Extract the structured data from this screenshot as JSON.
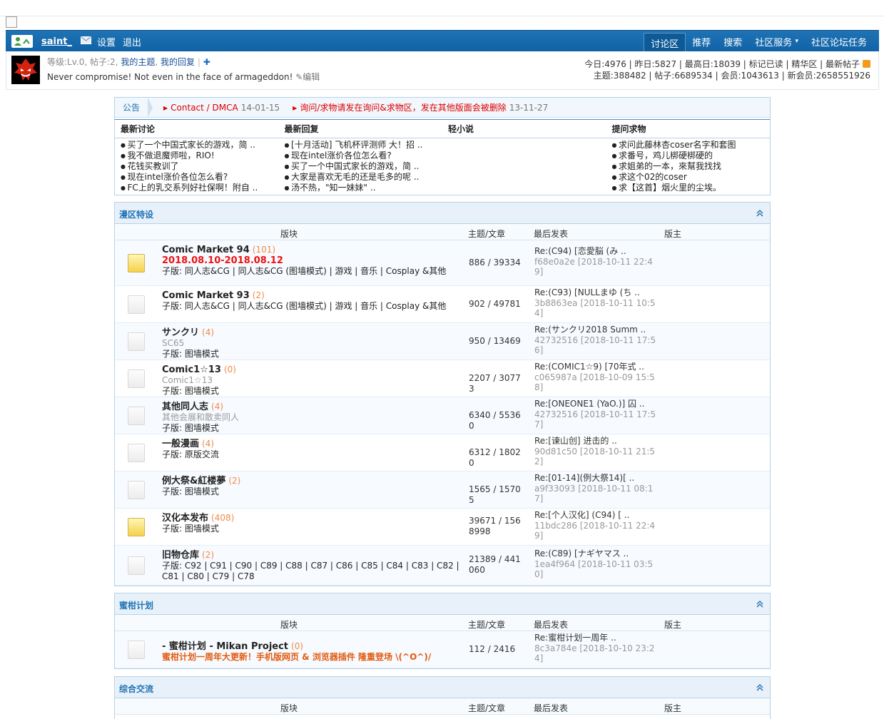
{
  "nav": {
    "username": "saint_",
    "settings": "设置",
    "logout": "退出",
    "items": [
      "讨论区",
      "推荐",
      "搜索",
      "社区服务",
      "社区论坛任务"
    ],
    "dropdown_suffix": "▾"
  },
  "userinfo": {
    "level_text": "等级:Lv.0, 帖子:2,",
    "my_topics": "我的主题",
    "sep": ",",
    "my_replies": "我的回复",
    "plus": "✚",
    "signature": "Never compromise! Not even in the face of armageddon!",
    "edit": "编辑",
    "stats_line1": "今日:4976 | 昨日:5827 | 最高日:18039 | 标记已读 | 精华区 | 最新帖子",
    "stats_line2": "主题:388482 | 帖子:6689534 | 会员:1043613 | 新会员:2658551926"
  },
  "notice": {
    "label": "公告",
    "items": [
      {
        "text": "Contact / DMCA",
        "date": "14-01-15"
      },
      {
        "text": "询问/求物请发在询问&求物区，发在其他版面会被删除",
        "date": "13-11-27"
      }
    ]
  },
  "latest": {
    "columns": [
      {
        "title": "最新讨论",
        "items": [
          "买了一个中国式家长的游戏，简 ..",
          "我不做退魔师啦，RIO!",
          "花钱买教训了",
          "现在intel涨价各位怎么看?",
          "FC上的乳交系列好社保啊！附自 .."
        ]
      },
      {
        "title": "最新回复",
        "items": [
          "[十月活动] 飞机杯评测师 大！招 ..",
          "现在intel涨价各位怎么看?",
          "买了一个中国式家长的游戏，简 ..",
          "大家是喜欢无毛的还是毛多的呢 ..",
          "汤不热，\"知一妹妹\" .."
        ]
      },
      {
        "title": "轻小说",
        "items": []
      },
      {
        "title": "提问求物",
        "items": [
          "求问此藤林杏coser名字和套图",
          "求番号，鸡儿梆硬梆硬的",
          "求姐弟的一本，來幫我找找",
          "求这个02的coser",
          "求【这首】烟火里的尘埃。"
        ]
      }
    ]
  },
  "colheads": {
    "forum": "版块",
    "topics": "主题/文章",
    "last": "最后发表",
    "mod": "版主"
  },
  "sections": [
    {
      "title": "漫区特设",
      "forums": [
        {
          "name": "Comic Market 94",
          "count": "(101)",
          "date": "2018.08.10-2018.08.12",
          "desc": "",
          "subs_line": "子版: 同人志&CG  | 同人志&CG (图墙模式)  | 游戏  | 音乐  | Cosplay  &其他",
          "stats": "886 / 39334",
          "last_title": "Re:(C94) [恋愛脳 (み ..",
          "last_meta": "f68e0a2e [2018-10-11 22:49]",
          "new": true
        },
        {
          "name": "Comic Market 93",
          "count": "(2)",
          "date": "",
          "desc": "",
          "subs_line": "子版: 同人志&CG  | 同人志&CG (图墙模式)  | 游戏  | 音乐  | Cosplay  &其他",
          "stats": "902 / 49781",
          "last_title": "Re:(C93) [NULLまゆ (ち ..",
          "last_meta": "3b8863ea [2018-10-11 10:54]",
          "new": false
        },
        {
          "name": "サンクリ",
          "count": "(4)",
          "date": "",
          "desc": "SC65",
          "subs_line": "子版: 图墙模式",
          "stats": "950 / 13469",
          "last_title": "Re:(サンクリ2018 Summ ..",
          "last_meta": "42732516 [2018-10-11 17:56]",
          "new": false
        },
        {
          "name": "Comic1☆13",
          "count": "(0)",
          "date": "",
          "desc": "Comic1☆13",
          "subs_line": "子版: 图墙模式",
          "stats": "2207 / 30773",
          "last_title": "Re:(COMIC1☆9) [70年式 ..",
          "last_meta": "c065987a [2018-10-09 15:58]",
          "new": false
        },
        {
          "name": "其他同人志",
          "count": "(4)",
          "date": "",
          "desc": "其他会展和散卖同人",
          "subs_line": "子版: 图墙模式",
          "stats": "6340 / 55360",
          "last_title": "Re:[ONEONE1 (YaO.)] 囚 ..",
          "last_meta": "42732516 [2018-10-11 17:57]",
          "new": false
        },
        {
          "name": "一般漫画",
          "count": "(4)",
          "date": "",
          "desc": "",
          "subs_line": "子版: 原版交流",
          "stats": "6312 / 18020",
          "last_title": "Re:[谏山创] 进击的 ..",
          "last_meta": "90d81c50 [2018-10-11 21:52]",
          "new": false
        },
        {
          "name": "例大祭&紅楼夢",
          "count": "(2)",
          "date": "",
          "desc": "",
          "subs_line": "子版: 图墙模式",
          "stats": "1565 / 15705",
          "last_title": "Re:[01-14](例大祭14)[ ..",
          "last_meta": "a9f33093 [2018-10-11 08:17]",
          "new": false
        },
        {
          "name": "汉化本发布",
          "count": "(408)",
          "date": "",
          "desc": "",
          "subs_line": "子版: 图墙模式",
          "stats": "39671 / 1568998",
          "last_title": "Re:[个人汉化] (C94) [ ..",
          "last_meta": "11bdc286 [2018-10-11 22:49]",
          "new": true
        },
        {
          "name": "旧物仓库",
          "count": "(2)",
          "date": "",
          "desc": "",
          "subs_line": "子版: C92  | C91  | C90  | C89  | C88  | C87  | C86  | C85  |  C84  | C83  | C82  | C81  | C80  | C79  | C78",
          "stats": "21389 / 441060",
          "last_title": "Re:(C89) [ナギヤマス ..",
          "last_meta": "1ea4f964 [2018-10-11 03:50]",
          "new": false
        }
      ]
    },
    {
      "title": "蜜柑计划",
      "forums": [
        {
          "name": "- 蜜柑计划 - Mikan Project",
          "count": "(0)",
          "note": "蜜柑计划一周年大更新！手机版网页 & 浏览器插件 隆重登场 \\(^O^)/",
          "stats": "112 / 2416",
          "last_title": "Re:蜜柑计划一周年 ..",
          "last_meta": "8c3a784e [2018-10-10 23:24]"
        }
      ]
    },
    {
      "title": "综合交流"
    }
  ],
  "colors": {
    "nav": "#1667ab",
    "accent": "#1f73b5",
    "red": "#dd1111",
    "count": "#f08a4b"
  }
}
